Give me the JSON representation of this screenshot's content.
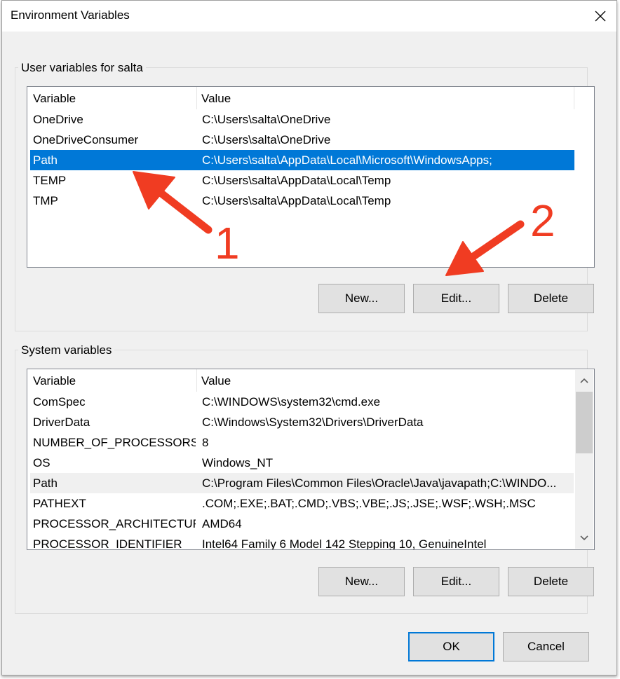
{
  "window": {
    "title": "Environment Variables"
  },
  "user_vars": {
    "group_label": "User variables for salta",
    "columns": [
      "Variable",
      "Value"
    ],
    "rows": [
      {
        "name": "OneDrive",
        "value": "C:\\Users\\salta\\OneDrive"
      },
      {
        "name": "OneDriveConsumer",
        "value": "C:\\Users\\salta\\OneDrive"
      },
      {
        "name": "Path",
        "value": "C:\\Users\\salta\\AppData\\Local\\Microsoft\\WindowsApps;"
      },
      {
        "name": "TEMP",
        "value": "C:\\Users\\salta\\AppData\\Local\\Temp"
      },
      {
        "name": "TMP",
        "value": "C:\\Users\\salta\\AppData\\Local\\Temp"
      }
    ],
    "selected_index": 2,
    "buttons": {
      "new": "New...",
      "edit": "Edit...",
      "delete": "Delete"
    }
  },
  "system_vars": {
    "group_label": "System variables",
    "columns": [
      "Variable",
      "Value"
    ],
    "rows": [
      {
        "name": "ComSpec",
        "value": "C:\\WINDOWS\\system32\\cmd.exe"
      },
      {
        "name": "DriverData",
        "value": "C:\\Windows\\System32\\Drivers\\DriverData"
      },
      {
        "name": "NUMBER_OF_PROCESSORS",
        "value": "8"
      },
      {
        "name": "OS",
        "value": "Windows_NT"
      },
      {
        "name": "Path",
        "value": "C:\\Program Files\\Common Files\\Oracle\\Java\\javapath;C:\\WINDO..."
      },
      {
        "name": "PATHEXT",
        "value": ".COM;.EXE;.BAT;.CMD;.VBS;.VBE;.JS;.JSE;.WSF;.WSH;.MSC"
      },
      {
        "name": "PROCESSOR_ARCHITECTURE",
        "value": "AMD64"
      },
      {
        "name": "PROCESSOR_IDENTIFIER",
        "value": "Intel64 Family 6 Model 142 Stepping 10, GenuineIntel"
      }
    ],
    "highlighted_index": 4,
    "buttons": {
      "new": "New...",
      "edit": "Edit...",
      "delete": "Delete"
    }
  },
  "footer": {
    "ok": "OK",
    "cancel": "Cancel"
  },
  "annotations": {
    "arrow_color": "#f03c22",
    "label_1": "1",
    "label_2": "2"
  },
  "colors": {
    "selection": "#0078d7",
    "dialog_bg": "#f0f0f0"
  },
  "icons": {
    "close": "close-icon",
    "scroll_up": "chevron-up-icon",
    "scroll_down": "chevron-down-icon"
  }
}
